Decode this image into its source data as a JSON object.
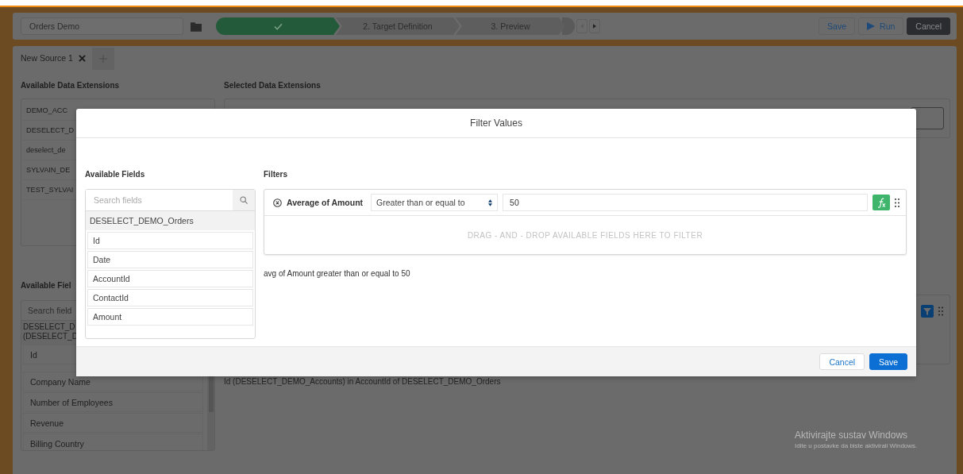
{
  "header": {
    "name_field": "Orders Demo",
    "steps": [
      {
        "completed": true
      },
      {
        "label": "2. Target Definition",
        "completed": false
      },
      {
        "label": "3. Preview",
        "completed": false
      }
    ],
    "actions": [
      {
        "label": "Save",
        "kind": "link"
      },
      {
        "label": "Run",
        "kind": "run"
      },
      {
        "label": "Cancel",
        "kind": "dark"
      }
    ]
  },
  "tabs": [
    {
      "label": "New Source 1",
      "selected": true
    }
  ],
  "available_data_extensions": {
    "title": "Available Data Extensions",
    "items": [
      "DEMO_ACC",
      "DESELECT_D",
      "deselect_de",
      "SYLVAIN_DE",
      "TEST_SYLVAI"
    ]
  },
  "selected_data_extensions": {
    "title": "Selected Data Extensions"
  },
  "available_fields": {
    "title": "Available Fiel",
    "search_placeholder": "Search field",
    "items": [
      {
        "kind": "group",
        "lines": [
          "DESELECT_D",
          "(DESELECT_D"
        ]
      },
      {
        "kind": "field",
        "lines": [
          "Id"
        ]
      },
      {
        "kind": "field",
        "lines": [
          "Company Name"
        ]
      },
      {
        "kind": "field",
        "lines": [
          "Number of Employees"
        ]
      },
      {
        "kind": "field",
        "lines": [
          "Revenue"
        ]
      },
      {
        "kind": "field",
        "lines": [
          "Billing Country"
        ]
      }
    ]
  },
  "relation_text": "Id (DESELECT_DEMO_Accounts) in AccountId of DESELECT_DEMO_Orders",
  "modal": {
    "title": "Filter Values",
    "fields_title": "Available Fields",
    "search_placeholder": "Search fields",
    "group": "DESELECT_DEMO_Orders",
    "fields": [
      "Id",
      "Date",
      "AccountId",
      "ContactId",
      "Amount"
    ],
    "filters_title": "Filters",
    "filters": [
      {
        "field": "Average of Amount",
        "operator": "Greater than or equal to",
        "value": "50"
      }
    ],
    "drop_hint": "DRAG - AND - DROP AVAILABLE FIELDS HERE TO FILTER",
    "summary": "avg of Amount greater than or equal to 50",
    "buttons": [
      {
        "label": "Cancel",
        "kind": "neutral"
      },
      {
        "label": "Save",
        "kind": "brand"
      }
    ]
  },
  "os_notice": {
    "title": "Aktivirajte sustav Windows",
    "text": "Idite u postavke da biste aktivirali Windows."
  }
}
